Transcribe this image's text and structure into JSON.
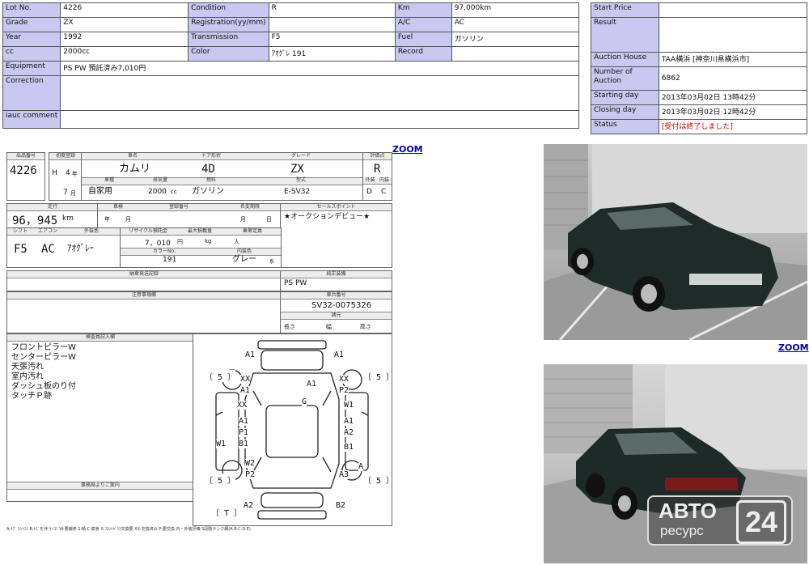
{
  "info_table": {
    "lot_no_label": "Lot No.",
    "lot_no": "4226",
    "condition_label": "Condition",
    "condition": "R",
    "km_label": "Km",
    "km": "97,000km",
    "grade_label": "Grade",
    "grade": "ZX",
    "registration_label": "Registration(yy/mm)",
    "registration": "",
    "ac_label": "A/C",
    "ac": "AC",
    "year_label": "Year",
    "year": "1992",
    "transmission_label": "Transmission",
    "transmission": "F5",
    "fuel_label": "Fuel",
    "fuel": "ガソリン",
    "cc_label": "cc",
    "cc": "2000cc",
    "color_label": "Color",
    "color": "ｱｵｸﾞﾚ 191",
    "record_label": "Record",
    "record": "",
    "equipment_label": "Equipment",
    "equipment": "PS PW 預託済み7,010円",
    "correction_label": "Correction",
    "correction": "",
    "iauc_label": "iauc comment",
    "iauc": ""
  },
  "auction_table": {
    "start_price_label": "Start Price",
    "start_price": "",
    "result_label": "Result",
    "result": "",
    "house_label": "Auction House",
    "house": "TAA横浜 [神奈川県横浜市]",
    "number_label": "Number of Auction",
    "number": "6862",
    "starting_label": "Starting day",
    "starting": "2013年03月02日 13時42分",
    "closing_label": "Closing day",
    "closing": "2013年03月02日 12時42分",
    "status_label": "Status",
    "status": "[受付は終了しました]",
    "status_color": "#cc0000"
  },
  "links": {
    "zoom": "ZOOM"
  },
  "sheet": {
    "h_lot": "出品番号",
    "h_reg": "初度登録",
    "h_model": "車名",
    "h_door": "ドア形状",
    "h_grade": "グレード",
    "h_score": "評価点",
    "lot": "4226",
    "era": "H",
    "era_year": "4",
    "year_unit": "年",
    "month": "7",
    "month_unit": "月",
    "model": "カムリ",
    "doors": "4D",
    "grade": "ZX",
    "score": "R",
    "h_use": "車種",
    "h_disp": "排気量",
    "h_fuel": "燃料",
    "h_type": "型式",
    "h_ext": "外装",
    "h_int": "内装",
    "use": "自家用",
    "displacement": "2000",
    "disp_unit": "cc",
    "fuel": "ガソリン",
    "type": "E-SV32",
    "ext": "D",
    "int": "C",
    "h_km": "走行",
    "km": "96，945",
    "km_unit": "km",
    "h_inspect": "車検",
    "h_regno": "登録番号",
    "h_name": "名変期限",
    "h_sales": "セールスポイント",
    "insp_year": "年",
    "insp_month": "月",
    "name_month": "月",
    "name_day": "日",
    "sales_point": "★オークションデビュー★",
    "h_shift": "シフト",
    "h_aircon": "エアコン",
    "h_color": "外装色",
    "h_recycle": "リサイクル預託金",
    "h_maxload": "最大積載量",
    "h_capacity": "乗車定員",
    "shift": "F5",
    "aircon": "AC",
    "color": "ｱｵｸﾞﾚｰ",
    "recycle": "7，010",
    "recycle_unit": "円",
    "load_unit": "kg",
    "cap_unit": "人",
    "h_colorno": "カラーNo.",
    "h_intcolor": "内装色",
    "colorno": "191",
    "intcolor": "グレー",
    "intcolor_unit": "系",
    "h_delivery": "納車発送記録",
    "h_equip": "純正装備",
    "equip": "PS PW",
    "h_notes": "注意事項欄",
    "h_chassis": "車台番号",
    "chassis": "SV32-0075326",
    "h_dims": "諸元",
    "dim_len": "長さ",
    "dim_wid": "幅",
    "dim_hgt": "高さ",
    "h_inspector": "検査員記入欄",
    "inspector_notes": [
      "フロントピラーW",
      "センターピラーW",
      "天張汚れ",
      "室内汚れ",
      "ダッシュ板のり付",
      "タッチＰ跡"
    ],
    "h_remarks": "事務局よりご案内",
    "footer": "A:ｷｽﾞ U:ﾍｺﾐ B:ｷｽﾞを伴うﾍｺﾐ W:要補修 S:錆 C:腐食 X:ﾌﾛﾝﾄｶﾞﾗｽ交換要 XX:交換済み P:要交換 内・外装評価 S段階ランク細(A·B·C·D·E)"
  },
  "diagram_marks": {
    "m1": "A1",
    "m2": "A1",
    "m3": "〔 5 〕",
    "m4": "〔 5 〕",
    "m5": "XX",
    "m6": "A1",
    "m7": "A1",
    "m8": "XX",
    "m9": "P2",
    "m10": "XX",
    "m11": "G",
    "m12": "W1",
    "m13": "A1",
    "m14": "A1",
    "m15": "P1",
    "m16": "A2",
    "m17": "W1",
    "m18": "B1",
    "m19": "B1",
    "m20": "W2",
    "m21": "A",
    "m22": "P2",
    "m23": "A3",
    "m24": "〔 5 〕",
    "m25": "〔 5 〕",
    "m26": "A2",
    "m27": "B2",
    "m28": "〔 T 〕"
  },
  "watermark": {
    "top": "АВТО",
    "bottom": "ресурс",
    "badge": "24"
  }
}
